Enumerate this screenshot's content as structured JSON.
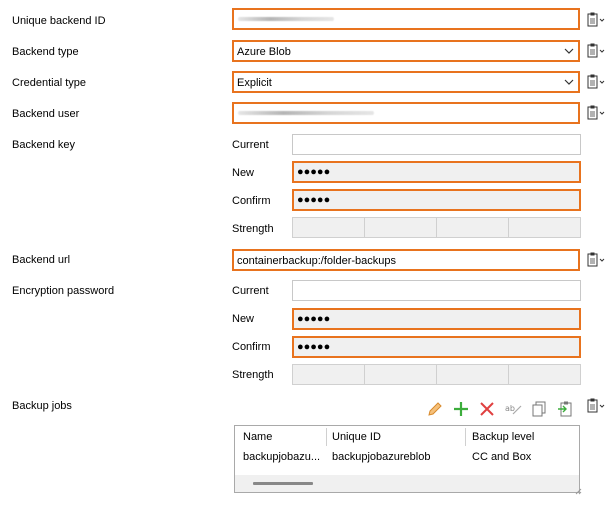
{
  "labels": {
    "unique_backend_id": "Unique backend ID",
    "backend_type": "Backend type",
    "credential_type": "Credential type",
    "backend_user": "Backend user",
    "backend_key": "Backend key",
    "backend_url": "Backend url",
    "encryption_password": "Encryption password",
    "backup_jobs": "Backup jobs"
  },
  "sublabels": {
    "current": "Current",
    "new": "New",
    "confirm": "Confirm",
    "strength": "Strength"
  },
  "fields": {
    "backend_type_value": "Azure Blob",
    "credential_type_value": "Explicit",
    "backend_url_value": "containerbackup:/folder-backups",
    "masked": "●●●●●"
  },
  "grid": {
    "columns": [
      "Name",
      "Unique ID",
      "Backup level"
    ],
    "rows": [
      [
        "backupjobazu...",
        "backupjobazureblob",
        "CC and Box"
      ]
    ]
  },
  "colors": {
    "accent_border": "#e8731e",
    "field_gray": "#f0f0f0"
  },
  "icons": [
    "clipboard-icon",
    "chevron-down-icon",
    "edit-icon",
    "add-icon",
    "delete-icon",
    "spellcheck-icon",
    "copy-icon",
    "paste-icon"
  ]
}
